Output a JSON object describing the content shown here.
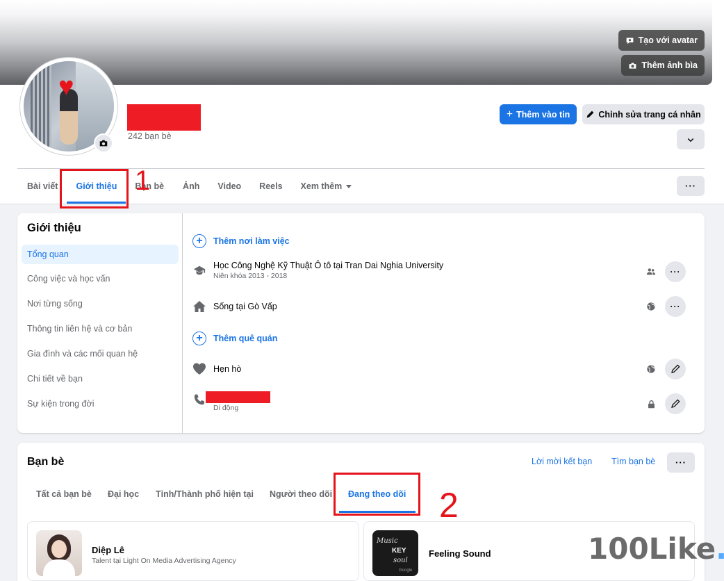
{
  "cover": {
    "avatar_button": "Tạo với avatar",
    "cover_photo_button": "Thêm ảnh bìa"
  },
  "profile": {
    "friend_count": "242 bạn bè",
    "add_story_button": "Thêm vào tin",
    "edit_profile_button": "Chỉnh sửa trang cá nhân",
    "more_icon": "chevron-down-icon"
  },
  "tabs": [
    {
      "label": "Bài viết"
    },
    {
      "label": "Giới thiệu",
      "active": true
    },
    {
      "label": "Bạn bè"
    },
    {
      "label": "Ảnh"
    },
    {
      "label": "Video"
    },
    {
      "label": "Reels"
    },
    {
      "label": "Xem thêm"
    }
  ],
  "annotations": {
    "mark1": "1",
    "mark2": "2"
  },
  "about": {
    "title": "Giới thiệu",
    "menu": [
      {
        "label": "Tổng quan",
        "active": true
      },
      {
        "label": "Công việc và học vấn"
      },
      {
        "label": "Nơi từng sống"
      },
      {
        "label": "Thông tin liên hệ và cơ bản"
      },
      {
        "label": "Gia đình và các mối quan hệ"
      },
      {
        "label": "Chi tiết về bạn"
      },
      {
        "label": "Sự kiện trong đời"
      }
    ],
    "add_workplace": "Thêm nơi làm việc",
    "education_prefix": "Học Công Nghệ Kỹ Thuật Ô tô tại ",
    "education_school": "Tran Dai Nghia University",
    "education_years": "Niên khóa 2013 - 2018",
    "lives_prefix": "Sống tại ",
    "lives_place": "Gò Vấp",
    "add_hometown": "Thêm quê quán",
    "dating": "Hẹn hò",
    "phone_type": "Di động"
  },
  "friends": {
    "title": "Bạn bè",
    "requests_link": "Lời mời kết bạn",
    "find_link": "Tìm bạn bè",
    "tabs": [
      {
        "label": "Tất cả bạn bè"
      },
      {
        "label": "Đại học"
      },
      {
        "label": "Tỉnh/Thành phố hiện tại"
      },
      {
        "label": "Người theo dõi"
      },
      {
        "label": "Đang theo dõi",
        "active": true
      }
    ],
    "items": [
      {
        "name": "Diệp Lê",
        "subtitle": "Talent tại Light On Media Advertising Agency"
      },
      {
        "name": "Feeling Sound",
        "subtitle": ""
      }
    ],
    "thumb_text": {
      "line1": "Music",
      "line2": "KEY",
      "line3": "soul",
      "brand": "Google"
    }
  },
  "watermark": {
    "text": "100Like",
    "dot": "."
  },
  "colors": {
    "accent": "#1b74e4",
    "mark": "#e5141b",
    "redaction": "#ee1c25"
  }
}
